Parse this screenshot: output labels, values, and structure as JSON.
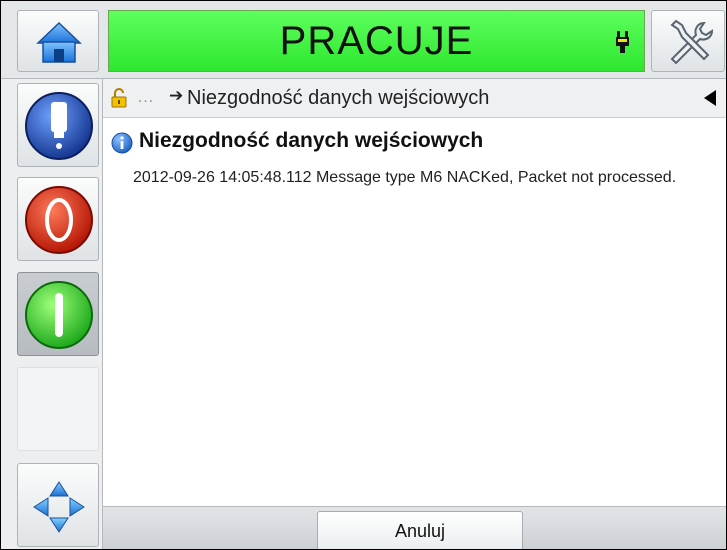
{
  "header": {
    "status": "PRACUJE"
  },
  "icons": {
    "home": "home-icon",
    "tools": "wrench-screwdriver-icon",
    "plug": "plug-icon",
    "ink": "ink-bottle-icon",
    "stop": "stop-icon",
    "start": "start-icon",
    "navigate": "four-way-arrows-icon",
    "lock": "open-lock-icon",
    "info": "info-icon",
    "back": "back-triangle-icon"
  },
  "breadcrumb": {
    "ellipsis": "…",
    "arrow": "➔",
    "label": "Niezgodność danych wejściowych"
  },
  "message": {
    "title": "Niezgodność danych wejściowych",
    "body": "2012-09-26 14:05:48.112 Message type M6 NACKed, Packet not processed."
  },
  "footer": {
    "cancel_label": "Anuluj"
  },
  "colors": {
    "status_green": "#3ef23e",
    "stop_red": "#e02010",
    "start_green": "#2fd62f",
    "ink_blue": "#1f4fb5",
    "info_blue": "#2e74d8"
  }
}
